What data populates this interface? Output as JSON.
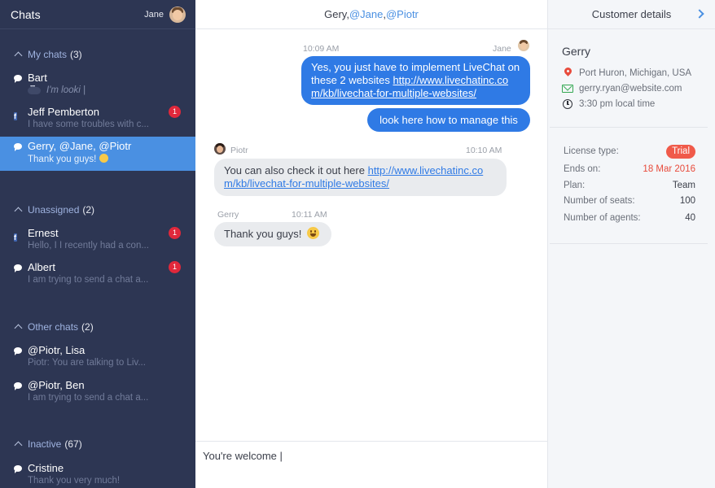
{
  "sidebar": {
    "title": "Chats",
    "user": "Jane",
    "sections": [
      {
        "label": "My chats",
        "count": "(3)"
      },
      {
        "label": "Unassigned",
        "count": "(2)"
      },
      {
        "label": "Other chats",
        "count": "(2)"
      },
      {
        "label": "Inactive",
        "count": "(67)"
      }
    ],
    "chats": {
      "bart": {
        "name": "Bart",
        "preview": "I'm looki |"
      },
      "jeff": {
        "name": "Jeff Pemberton",
        "preview": "I have some troubles with c...",
        "badge": "1"
      },
      "gerry": {
        "name": "Gerry, @Jane, @Piotr",
        "preview": "Thank you guys!"
      },
      "ernest": {
        "name": "Ernest",
        "preview": "Hello, I  I recently had a con...",
        "badge": "1"
      },
      "albert": {
        "name": "Albert",
        "preview": "I am trying to send a chat a...",
        "badge": "1"
      },
      "piotr_lisa": {
        "name": "@Piotr, Lisa",
        "preview": "Piotr: You are talking to Liv..."
      },
      "piotr_ben": {
        "name": "@Piotr, Ben",
        "preview": "I am trying to send a chat a..."
      },
      "cristine": {
        "name": "Cristine",
        "preview": "Thank you very much!"
      }
    }
  },
  "main": {
    "header": {
      "p1": "Gery, ",
      "m1": "@Jane",
      "p2": ", ",
      "m2": "@Piotr"
    },
    "messages": {
      "m1": {
        "time": "10:09 AM",
        "author": "Jane",
        "text": "Yes, you just have to implement LiveChat on these 2 websites ",
        "link1": "http://www.livechatinc.co",
        "link2": "m/kb/livechat-for-multiple-websites/"
      },
      "m2": {
        "text": "look here how to manage this"
      },
      "m3": {
        "author": "Piotr",
        "time": "10:10 AM",
        "text": "You can also check it out here ",
        "link1": "http://www.livechatinc.co",
        "link2": "m/kb/livechat-for-multiple-websites/"
      },
      "m4": {
        "author": "Gerry",
        "time": "10:11 AM",
        "text": "Thank you guys!"
      }
    },
    "composer_text": "You're welcome |"
  },
  "details": {
    "title": "Customer details",
    "name": "Gerry",
    "location": "Port Huron, Michigan, USA",
    "email": "gerry.ryan@website.com",
    "local_time": "3:30 pm local time",
    "license_type_label": "License type:",
    "license_type": "Trial",
    "ends_on_label": "Ends on:",
    "ends_on": "18 Mar 2016",
    "plan_label": "Plan:",
    "plan": "Team",
    "seats_label": "Number of seats:",
    "seats": "100",
    "agents_label": "Number of agents:",
    "agents": "40"
  },
  "colors": {
    "sidebar_bg": "#2d3653",
    "accent": "#4a90e2",
    "outgoing_bubble": "#2f7ae5",
    "badge": "#e0283b",
    "trial": "#f05a4a"
  }
}
